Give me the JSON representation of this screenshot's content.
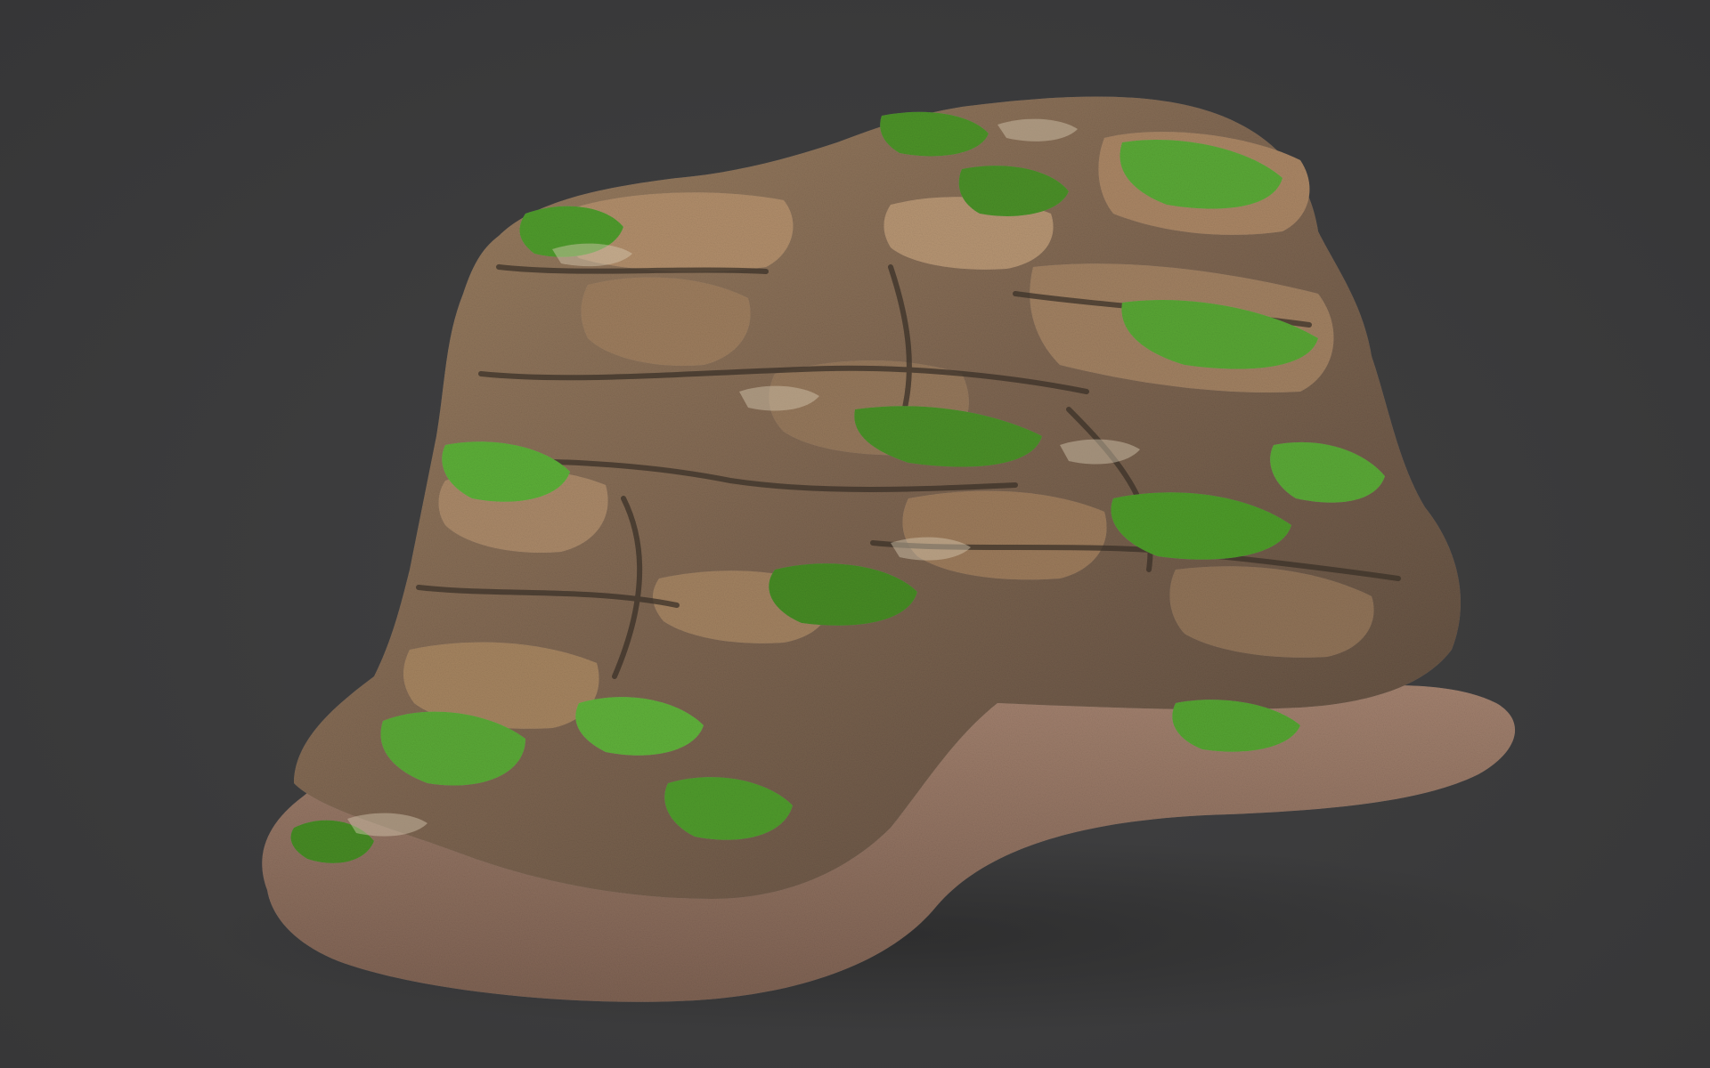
{
  "scene": {
    "subject": "mossy-rock-cliff-model",
    "colors": {
      "background": "#3a3a3b",
      "rock_light": "#a98a68",
      "rock_mid": "#8a6e52",
      "rock_dark": "#4e4236",
      "moss_bright": "#5fae35",
      "moss_dark": "#3d7a24",
      "base_soil": "#9b7a68",
      "base_soil_dark": "#7a5e50"
    }
  }
}
